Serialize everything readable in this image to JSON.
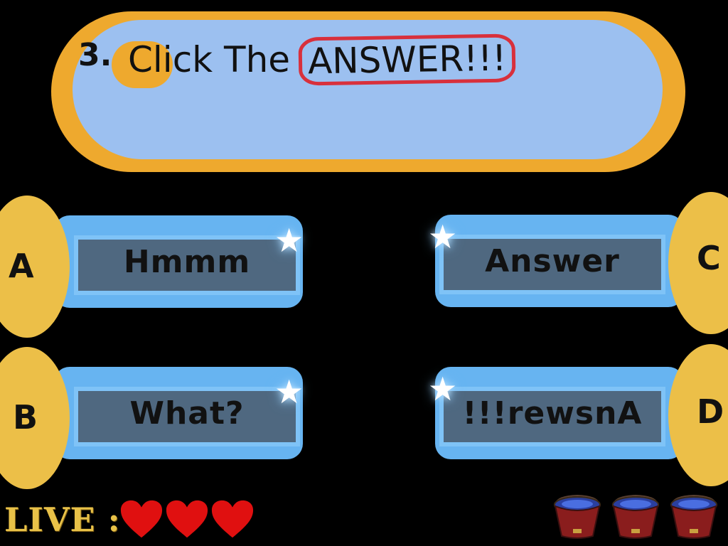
{
  "question": {
    "number": "3.",
    "text_plain": "Click The",
    "text_highlight": "ANSWER!!!"
  },
  "options": [
    {
      "letter": "A",
      "text": "Hmmm"
    },
    {
      "letter": "B",
      "text": "What?"
    },
    {
      "letter": "C",
      "text": "Answer"
    },
    {
      "letter": "D",
      "text": "!!!rewsnA"
    }
  ],
  "lives": {
    "label": "LIVE :",
    "hearts": 3,
    "heart_color": "#e01010"
  },
  "buckets": {
    "count": 3
  },
  "colors": {
    "banner_orange": "#eea92e",
    "banner_blue": "#9cc0f0",
    "option_disc": "#ecbf48",
    "option_bar": "#4f6880",
    "option_border": "#7fc3f7",
    "highlight_ring": "#d8303c"
  }
}
